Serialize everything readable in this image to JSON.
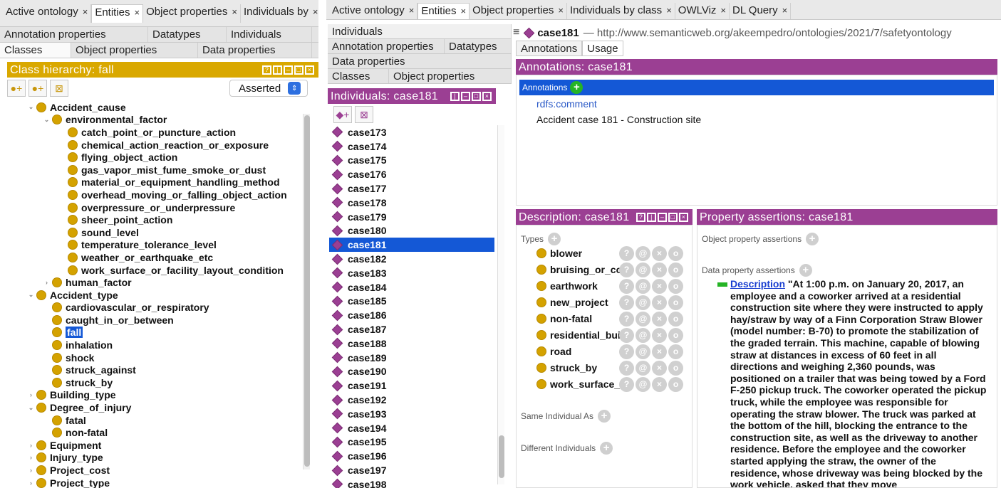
{
  "left": {
    "tabs": [
      "Active ontology",
      "Entities",
      "Object properties",
      "Individuals by"
    ],
    "active_tab": "Entities",
    "row1_subtabs": [
      "Annotation properties",
      "Datatypes",
      "Individuals"
    ],
    "row2_subtabs": [
      "Classes",
      "Object properties",
      "Data properties"
    ],
    "header": "Class hierarchy: fall",
    "asserted_label": "Asserted",
    "tree": [
      {
        "label": "Accident_cause",
        "level": 0,
        "disc": "open"
      },
      {
        "label": "environmental_factor",
        "level": 1,
        "disc": "open"
      },
      {
        "label": "catch_point_or_puncture_action",
        "level": 2,
        "disc": ""
      },
      {
        "label": "chemical_action_reaction_or_exposure",
        "level": 2,
        "disc": ""
      },
      {
        "label": "flying_object_action",
        "level": 2,
        "disc": ""
      },
      {
        "label": "gas_vapor_mist_fume_smoke_or_dust",
        "level": 2,
        "disc": ""
      },
      {
        "label": "material_or_equipment_handling_method",
        "level": 2,
        "disc": ""
      },
      {
        "label": "overhead_moving_or_falling_object_action",
        "level": 2,
        "disc": ""
      },
      {
        "label": "overpressure_or_underpressure",
        "level": 2,
        "disc": ""
      },
      {
        "label": "sheer_point_action",
        "level": 2,
        "disc": ""
      },
      {
        "label": "sound_level",
        "level": 2,
        "disc": ""
      },
      {
        "label": "temperature_tolerance_level",
        "level": 2,
        "disc": ""
      },
      {
        "label": "weather_or_earthquake_etc",
        "level": 2,
        "disc": ""
      },
      {
        "label": "work_surface_or_facility_layout_condition",
        "level": 2,
        "disc": ""
      },
      {
        "label": "human_factor",
        "level": 1,
        "disc": "closed"
      },
      {
        "label": "Accident_type",
        "level": 0,
        "disc": "open"
      },
      {
        "label": "cardiovascular_or_respiratory",
        "level": 1,
        "disc": ""
      },
      {
        "label": "caught_in_or_between",
        "level": 1,
        "disc": ""
      },
      {
        "label": "fall",
        "level": 1,
        "disc": "",
        "selected": true
      },
      {
        "label": "inhalation",
        "level": 1,
        "disc": ""
      },
      {
        "label": "shock",
        "level": 1,
        "disc": ""
      },
      {
        "label": "struck_against",
        "level": 1,
        "disc": ""
      },
      {
        "label": "struck_by",
        "level": 1,
        "disc": ""
      },
      {
        "label": "Building_type",
        "level": 0,
        "disc": "closed"
      },
      {
        "label": "Degree_of_injury",
        "level": 0,
        "disc": "open"
      },
      {
        "label": "fatal",
        "level": 1,
        "disc": ""
      },
      {
        "label": "non-fatal",
        "level": 1,
        "disc": ""
      },
      {
        "label": "Equipment",
        "level": 0,
        "disc": "closed"
      },
      {
        "label": "Injury_type",
        "level": 0,
        "disc": "closed"
      },
      {
        "label": "Project_cost",
        "level": 0,
        "disc": "closed"
      },
      {
        "label": "Project_type",
        "level": 0,
        "disc": "closed"
      }
    ]
  },
  "right": {
    "tabs": [
      "Active ontology",
      "Entities",
      "Object properties",
      "Individuals by class",
      "OWLViz",
      "DL Query"
    ],
    "active_tab": "Entities",
    "nav_rows": {
      "r1": [
        "Individuals"
      ],
      "r2": [
        "Annotation properties",
        "Datatypes"
      ],
      "r3": [
        "Data properties"
      ],
      "r4": [
        "Classes",
        "Object properties"
      ]
    },
    "individuals_header": "Individuals: case181",
    "individuals": [
      "case173",
      "case174",
      "case175",
      "case176",
      "case177",
      "case178",
      "case179",
      "case180",
      "case181",
      "case182",
      "case183",
      "case184",
      "case185",
      "case186",
      "case187",
      "case188",
      "case189",
      "case190",
      "case191",
      "case192",
      "case193",
      "case194",
      "case195",
      "case196",
      "case197",
      "case198"
    ],
    "selected_individual": "case181",
    "entity_title": "case181",
    "entity_iri": "— http://www.semanticweb.org/akeempedro/ontologies/2021/7/safetyontology",
    "entity_tabs": [
      "Annotations",
      "Usage"
    ],
    "annotations_header": "Annotations: case181",
    "annotations_label": "Annotations",
    "annotation_property": "rdfs:comment",
    "annotation_value": "Accident case 181 - Construction site",
    "description_header": "Description: case181",
    "types_label": "Types",
    "types": [
      "blower",
      "bruising_or_co",
      "earthwork",
      "new_project",
      "non-fatal",
      "residential_bui",
      "road",
      "struck_by",
      "work_surface_c"
    ],
    "same_individual_label": "Same Individual As",
    "different_individuals_label": "Different Individuals",
    "property_header": "Property assertions: case181",
    "object_prop_label": "Object property assertions",
    "data_prop_label": "Data property assertions",
    "data_prop_name": "Description",
    "data_prop_value": "\"At 1:00 p.m. on January 20, 2017, an employee and a coworker arrived at a residential construction site where they were instructed to apply hay/straw by way of a Finn Corporation Straw Blower (model number: B-70) to promote the stabilization of the graded terrain. This machine, capable of blowing straw at distances in excess of 60 feet in all directions and weighing 2,360 pounds, was positioned on a trailer that was being towed by a Ford F-250 pickup truck. The coworker operated the pickup truck, while the employee was responsible for operating the straw blower.  The truck was parked at the bottom of the hill, blocking the entrance to the construction site, as well as the driveway to another residence.  Before the employee and the coworker started applying the straw, the owner of the residence, whose driveway was being blocked by the work vehicle, asked that they move"
  },
  "colors": {
    "accent_purple": "#9b3f93",
    "class_gold": "#d4a200",
    "selection_blue": "#1458d6",
    "add_green": "#25b425"
  }
}
